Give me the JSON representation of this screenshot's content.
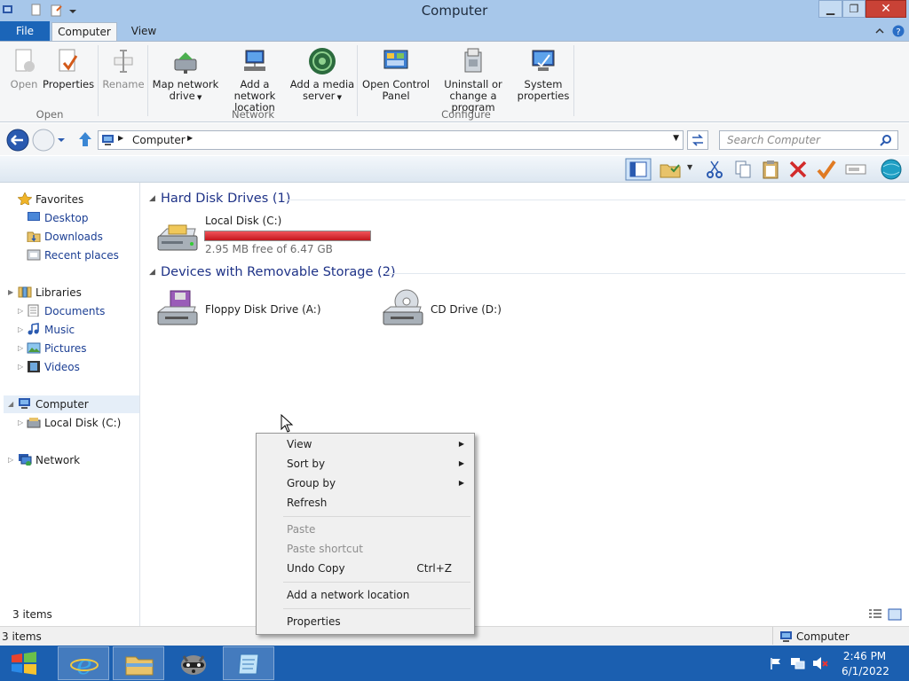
{
  "window": {
    "title": "Computer"
  },
  "tabs": {
    "file": "File",
    "computer": "Computer",
    "view": "View"
  },
  "ribbon": {
    "open": "Open",
    "properties": "Properties",
    "rename": "Rename",
    "map_drive": [
      "Map network",
      "drive"
    ],
    "add_location": [
      "Add a network",
      "location"
    ],
    "add_media": [
      "Add a media",
      "server"
    ],
    "control_panel": [
      "Open Control",
      "Panel"
    ],
    "uninstall": [
      "Uninstall or",
      "change a program"
    ],
    "system_props": [
      "System",
      "properties"
    ],
    "group_open": "Open",
    "group_network": "Network",
    "group_configure": "Configure"
  },
  "address": {
    "path": "Computer",
    "search_placeholder": "Search Computer"
  },
  "nav": {
    "favorites": "Favorites",
    "desktop": "Desktop",
    "downloads": "Downloads",
    "recent": "Recent places",
    "libraries": "Libraries",
    "documents": "Documents",
    "music": "Music",
    "pictures": "Pictures",
    "videos": "Videos",
    "computer": "Computer",
    "local_disk": "Local Disk (C:)",
    "network": "Network"
  },
  "content": {
    "hdd_header": "Hard Disk Drives (1)",
    "removable_header": "Devices with Removable Storage (2)",
    "local_disk": {
      "name": "Local Disk (C:)",
      "free": "2.95 MB free of 6.47 GB",
      "used_fraction": 0.9996
    },
    "floppy": "Floppy Disk Drive (A:)",
    "cd": "CD Drive (D:)"
  },
  "status": {
    "items_inner": "3 items",
    "items": "3 items",
    "location": "Computer"
  },
  "context_menu": {
    "view": "View",
    "sort_by": "Sort by",
    "group_by": "Group by",
    "refresh": "Refresh",
    "paste": "Paste",
    "paste_shortcut": "Paste shortcut",
    "undo_copy": "Undo Copy",
    "undo_shortcut": "Ctrl+Z",
    "add_network": "Add a network location",
    "properties": "Properties"
  },
  "clock": {
    "time": "2:46 PM",
    "date": "6/1/2022"
  },
  "colors": {
    "accent": "#1b65b8",
    "disk_bar": "#d8232a",
    "taskbar": "#1b5fb0",
    "title": "#a7c7ea"
  }
}
